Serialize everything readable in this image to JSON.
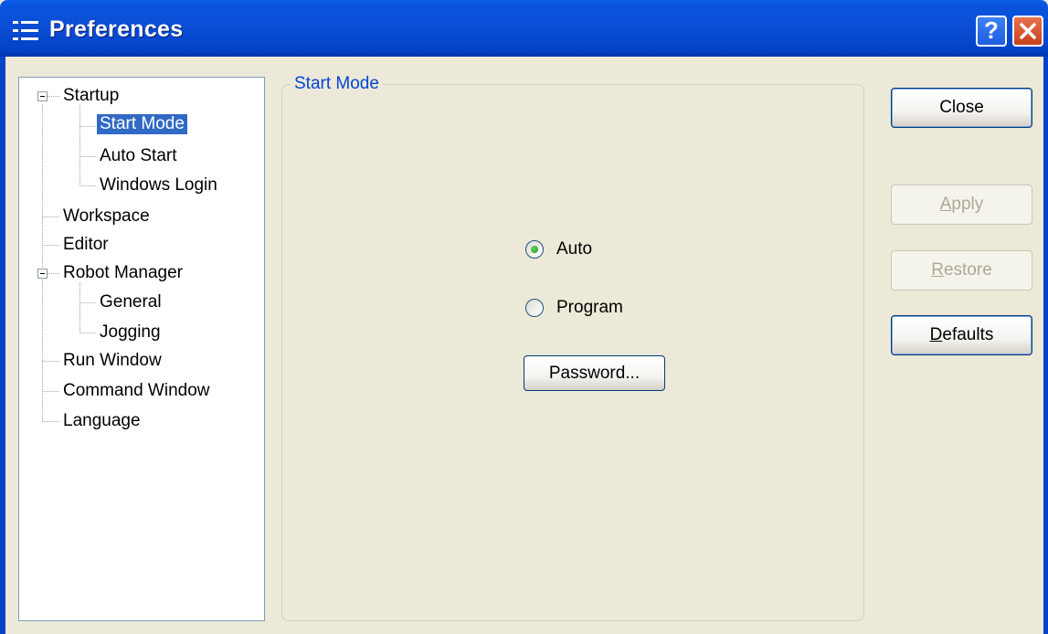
{
  "window": {
    "title": "Preferences"
  },
  "titlebar": {
    "help_glyph": "?"
  },
  "tree": {
    "items": [
      {
        "label": "Startup"
      },
      {
        "label": "Start Mode"
      },
      {
        "label": "Auto Start"
      },
      {
        "label": "Windows Login"
      },
      {
        "label": "Workspace"
      },
      {
        "label": "Editor"
      },
      {
        "label": "Robot Manager"
      },
      {
        "label": "General"
      },
      {
        "label": "Jogging"
      },
      {
        "label": "Run Window"
      },
      {
        "label": "Command Window"
      },
      {
        "label": "Language"
      }
    ],
    "selected": "Start Mode"
  },
  "start_mode": {
    "legend": "Start Mode",
    "options": [
      {
        "label": "Auto",
        "checked": true
      },
      {
        "label": "Program",
        "checked": false
      }
    ],
    "password_button": "Password..."
  },
  "actions": {
    "close": "Close",
    "apply_access": "A",
    "apply_rest": "pply",
    "restore_access": "R",
    "restore_rest": "estore",
    "defaults_access": "D",
    "defaults_rest": "efaults"
  },
  "colors": {
    "titlebar": "#0343c8",
    "selection": "#316ac5",
    "groupbox_title": "#0046d5",
    "radio_dot": "#21a121"
  }
}
